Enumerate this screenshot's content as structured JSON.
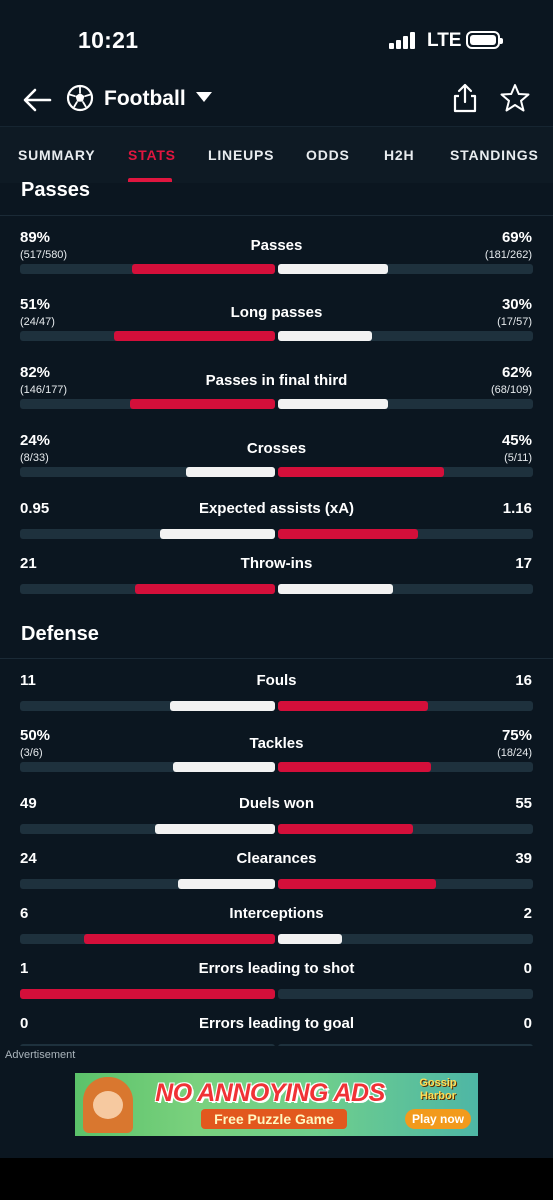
{
  "status_bar": {
    "time": "10:21",
    "network": "LTE"
  },
  "header": {
    "sport": "Football"
  },
  "tabs": [
    {
      "label": "SUMMARY",
      "active": false
    },
    {
      "label": "STATS",
      "active": true
    },
    {
      "label": "LINEUPS",
      "active": false
    },
    {
      "label": "ODDS",
      "active": false
    },
    {
      "label": "H2H",
      "active": false
    },
    {
      "label": "STANDINGS",
      "active": false
    }
  ],
  "colors": {
    "home_accent": "#d40f3a",
    "away_accent": "#f2f2f2",
    "active_tab": "#e0163f",
    "background": "#0b1620"
  },
  "passes": {
    "title": "Passes",
    "stats": [
      {
        "label": "Passes",
        "left": "89%",
        "left_sub": "(517/580)",
        "right": "69%",
        "right_sub": "(181/262)",
        "left_fill": 0.56,
        "right_fill": 0.43,
        "left_color": "red",
        "right_color": "white"
      },
      {
        "label": "Long passes",
        "left": "51%",
        "left_sub": "(24/47)",
        "right": "30%",
        "right_sub": "(17/57)",
        "left_fill": 0.63,
        "right_fill": 0.37,
        "left_color": "red",
        "right_color": "white"
      },
      {
        "label": "Passes in final third",
        "left": "82%",
        "left_sub": "(146/177)",
        "right": "62%",
        "right_sub": "(68/109)",
        "left_fill": 0.57,
        "right_fill": 0.43,
        "left_color": "red",
        "right_color": "white"
      },
      {
        "label": "Crosses",
        "left": "24%",
        "left_sub": "(8/33)",
        "right": "45%",
        "right_sub": "(5/11)",
        "left_fill": 0.35,
        "right_fill": 0.65,
        "left_color": "white",
        "right_color": "red"
      },
      {
        "label": "Expected assists (xA)",
        "left": "0.95",
        "right": "1.16",
        "left_fill": 0.45,
        "right_fill": 0.55,
        "left_color": "white",
        "right_color": "red"
      },
      {
        "label": "Throw-ins",
        "left": "21",
        "right": "17",
        "left_fill": 0.55,
        "right_fill": 0.45,
        "left_color": "red",
        "right_color": "white"
      }
    ]
  },
  "defense": {
    "title": "Defense",
    "stats": [
      {
        "label": "Fouls",
        "left": "11",
        "right": "16",
        "left_fill": 0.41,
        "right_fill": 0.59,
        "left_color": "white",
        "right_color": "red"
      },
      {
        "label": "Tackles",
        "left": "50%",
        "left_sub": "(3/6)",
        "right": "75%",
        "right_sub": "(18/24)",
        "left_fill": 0.4,
        "right_fill": 0.6,
        "left_color": "white",
        "right_color": "red"
      },
      {
        "label": "Duels won",
        "left": "49",
        "right": "55",
        "left_fill": 0.47,
        "right_fill": 0.53,
        "left_color": "white",
        "right_color": "red"
      },
      {
        "label": "Clearances",
        "left": "24",
        "right": "39",
        "left_fill": 0.38,
        "right_fill": 0.62,
        "left_color": "white",
        "right_color": "red"
      },
      {
        "label": "Interceptions",
        "left": "6",
        "right": "2",
        "left_fill": 0.75,
        "right_fill": 0.25,
        "left_color": "red",
        "right_color": "white"
      },
      {
        "label": "Errors leading to shot",
        "left": "1",
        "right": "0",
        "left_fill": 1.0,
        "right_fill": 0.0,
        "left_color": "red",
        "right_color": "white"
      },
      {
        "label": "Errors leading to goal",
        "left": "0",
        "right": "0",
        "left_fill": 0.0,
        "right_fill": 0.0,
        "left_color": "white",
        "right_color": "white"
      }
    ]
  },
  "ad": {
    "label": "Advertisement",
    "banner_title": "NO ANNOYING ADS",
    "banner_subtitle": "Free Puzzle Game",
    "banner_brand": "Gossip Harbor",
    "banner_cta": "Play now"
  }
}
